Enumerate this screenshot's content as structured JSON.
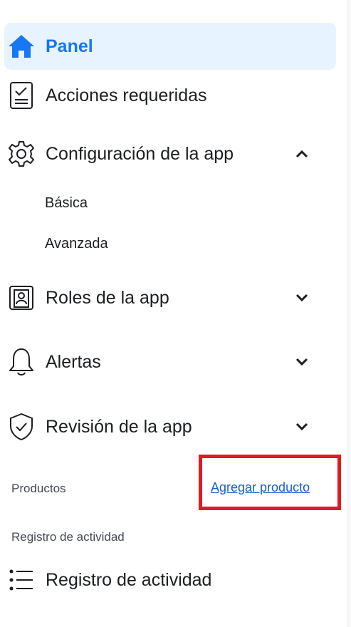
{
  "nav": {
    "dashboard": {
      "label": "Panel",
      "icon": "home-icon"
    },
    "required_actions": {
      "label": "Acciones requeridas",
      "icon": "checklist-icon"
    },
    "app_settings": {
      "label": "Configuración de la app",
      "icon": "gear-icon",
      "expanded": true,
      "children": {
        "basic": "Básica",
        "advanced": "Avanzada"
      }
    },
    "app_roles": {
      "label": "Roles de la app",
      "icon": "id-badge-icon",
      "expanded": false
    },
    "alerts": {
      "label": "Alertas",
      "icon": "bell-icon",
      "expanded": false
    },
    "app_review": {
      "label": "Revisión de la app",
      "icon": "shield-check-icon",
      "expanded": false
    }
  },
  "products": {
    "heading": "Productos",
    "add_link": "Agregar producto"
  },
  "activity": {
    "heading": "Registro de actividad",
    "item_label": "Registro de actividad",
    "icon": "list-icon"
  },
  "colors": {
    "accent": "#1877f2",
    "active_bg": "#e7f3ff",
    "highlight": "#e01b24",
    "link": "#1a5ec9"
  }
}
